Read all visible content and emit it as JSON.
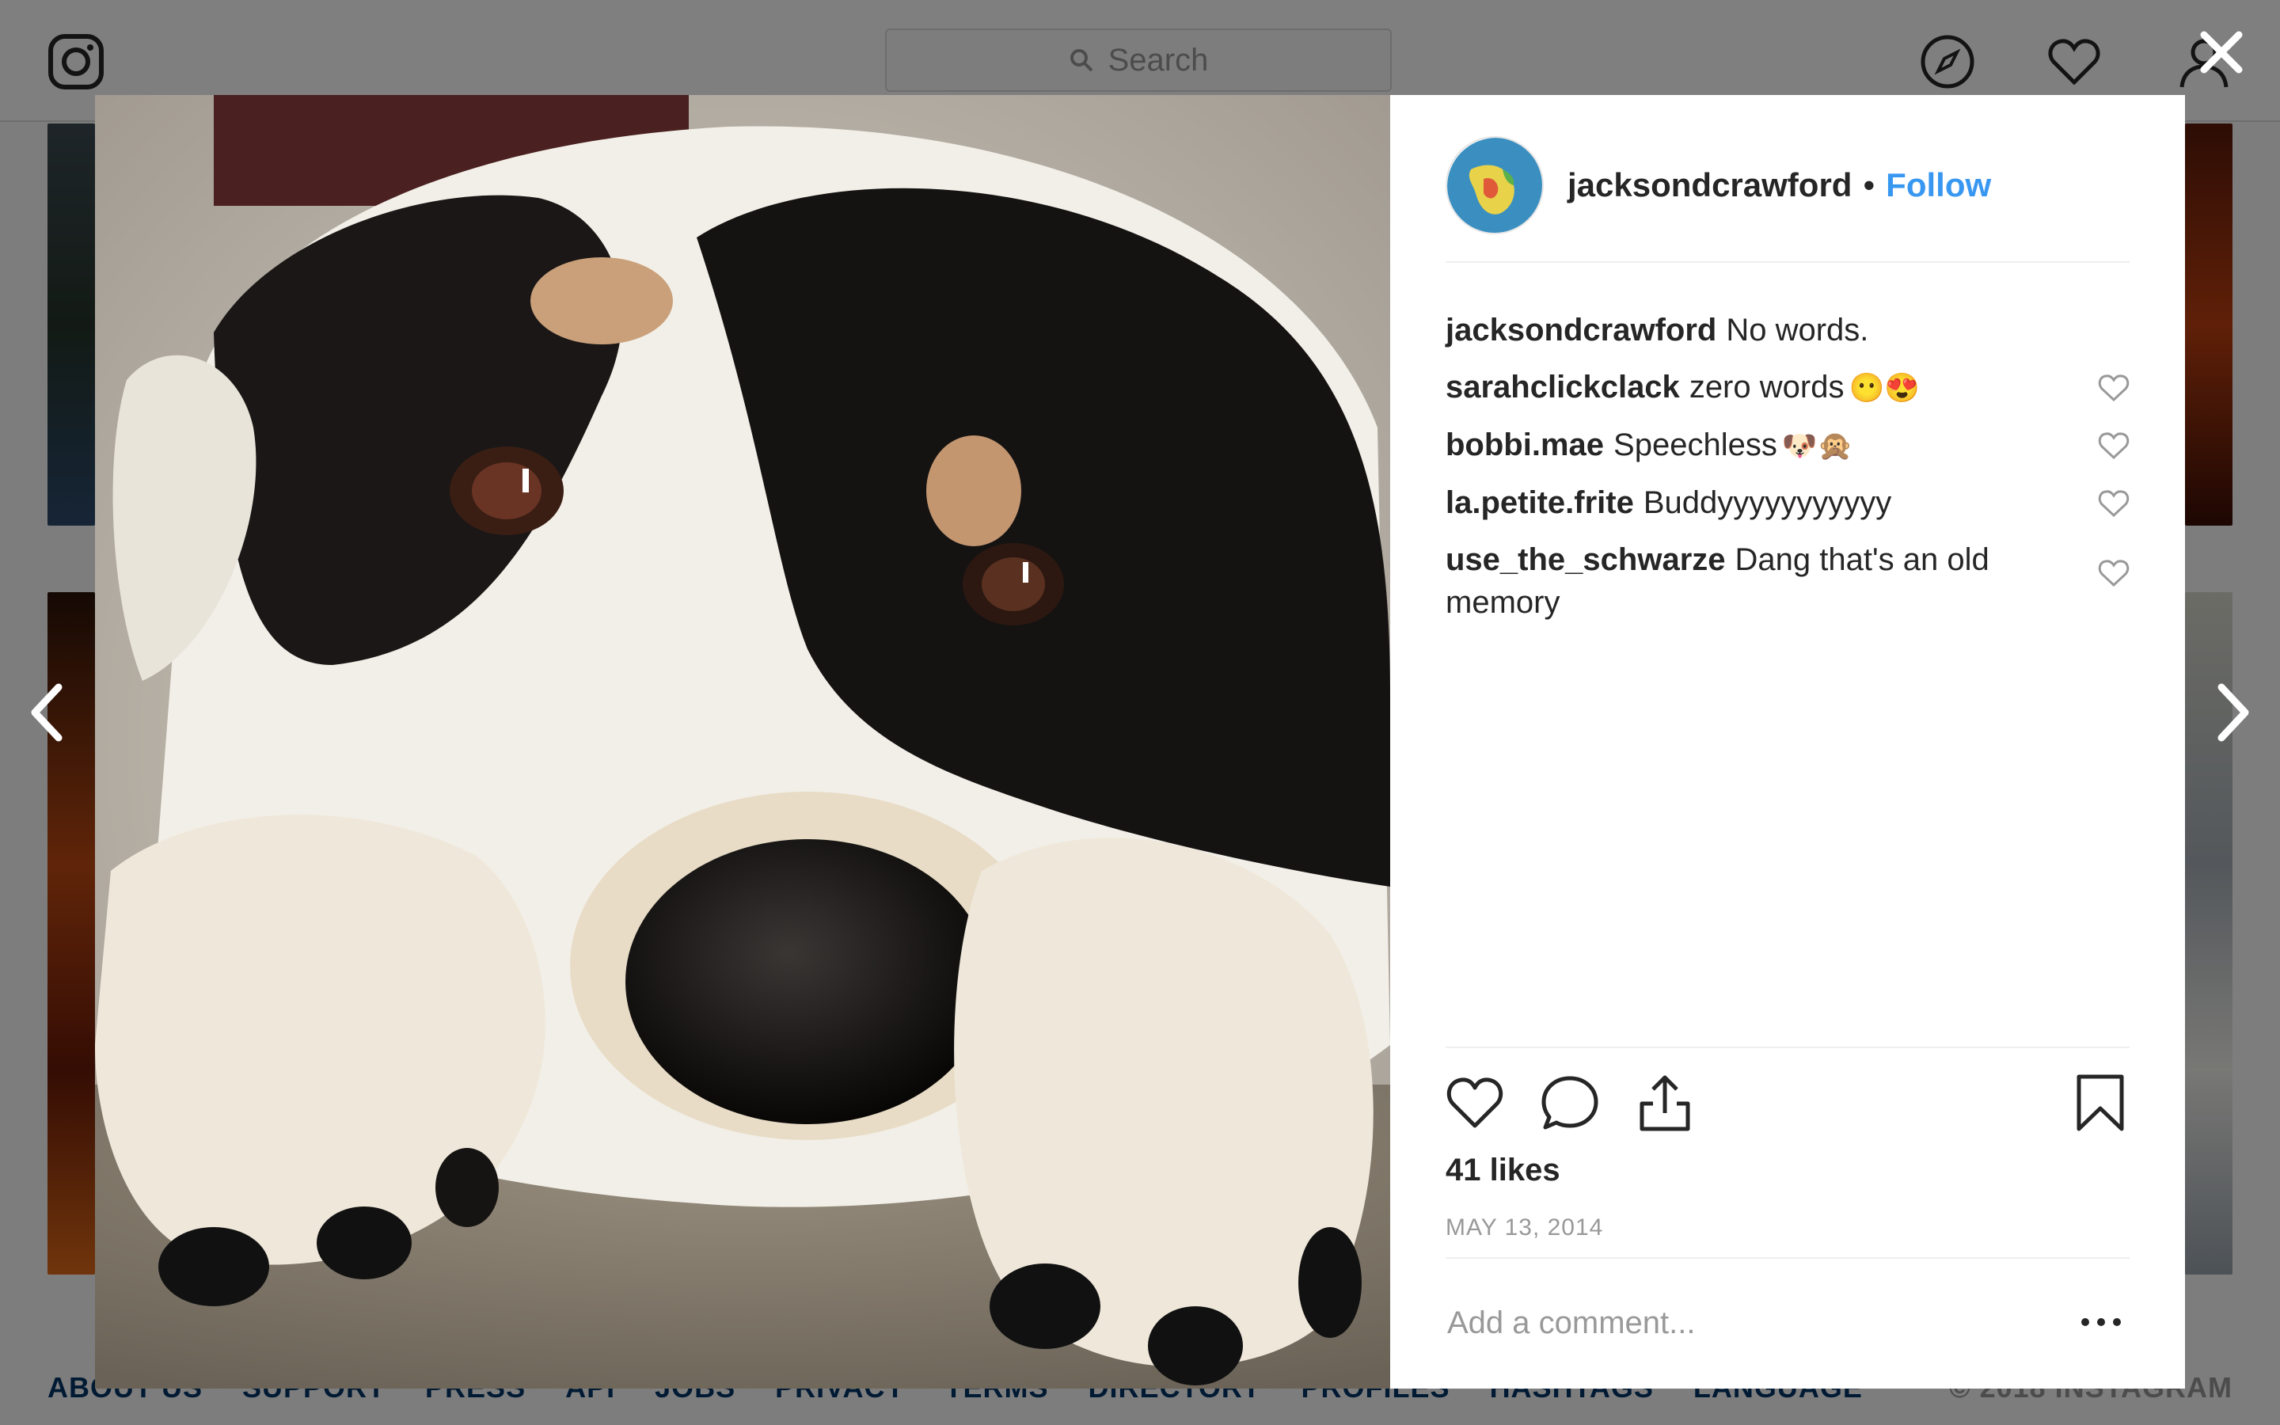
{
  "topbar": {
    "logo_icon": "instagram-icon",
    "search_placeholder": "Search",
    "search_icon": "search-icon",
    "nav_icons": [
      "compass-icon",
      "heart-icon",
      "profile-icon"
    ]
  },
  "footer": {
    "links": [
      "ABOUT US",
      "SUPPORT",
      "PRESS",
      "API",
      "JOBS",
      "PRIVACY",
      "TERMS",
      "DIRECTORY",
      "PROFILES",
      "HASHTAGS",
      "LANGUAGE"
    ],
    "copyright": "© 2018 INSTAGRAM"
  },
  "modal": {
    "close_icon": "close-icon",
    "prev_icon": "chevron-left-icon",
    "next_icon": "chevron-right-icon",
    "post": {
      "username": "jacksondcrawford",
      "separator": "•",
      "follow_label": "Follow",
      "comments": [
        {
          "user": "jacksondcrawford",
          "text": "No words.",
          "emoji": "",
          "likeable": false
        },
        {
          "user": "sarahclickclack",
          "text": "zero words",
          "emoji": "😶😍",
          "likeable": true
        },
        {
          "user": "bobbi.mae",
          "text": "Speechless",
          "emoji": "🐶🙊",
          "likeable": true
        },
        {
          "user": "la.petite.frite",
          "text": "Buddyyyyyyyyyyy",
          "emoji": "",
          "likeable": true
        },
        {
          "user": "use_the_schwarze",
          "text": "Dang that's an old memory",
          "emoji": "",
          "likeable": true
        }
      ],
      "likes": "41 likes",
      "date": "MAY 13, 2014",
      "comment_placeholder": "Add a comment...",
      "more_label": "•••"
    }
  },
  "colors": {
    "link_blue": "#3897f0",
    "text_dark": "#262626",
    "text_muted": "#999999",
    "divider": "#efefef"
  }
}
